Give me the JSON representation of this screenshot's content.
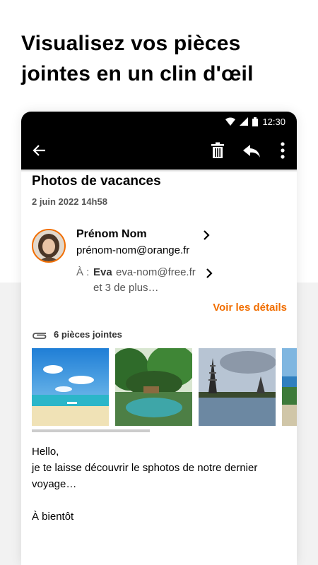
{
  "promo": {
    "headline_line1": "Visualisez vos pièces",
    "headline_line2": "jointes en un clin d'œil"
  },
  "status_bar": {
    "time": "12:30"
  },
  "toolbar": {
    "back_icon": "arrow-left-icon",
    "delete_icon": "trash-icon",
    "reply_icon": "reply-icon",
    "more_icon": "more-vertical-icon"
  },
  "message": {
    "subject": "Photos de vacances",
    "date": "2 juin 2022 14h58",
    "sender": {
      "name": "Prénom Nom",
      "email": "prénom-nom@orange.fr"
    },
    "recipients": {
      "prefix": "À :",
      "first_name": "Eva",
      "first_email": "eva-nom@free.fr",
      "more": "et 3 de plus…"
    },
    "details_link": "Voir les détails",
    "attachments": {
      "count_label": "6 pièces jointes",
      "items": [
        "beach",
        "tropical-garden",
        "temple-lake",
        "coast"
      ]
    },
    "body": [
      "Hello,",
      "je te laisse découvrir le sphotos de notre dernier",
      "voyage…",
      "",
      "À bientôt"
    ]
  },
  "colors": {
    "accent": "#f16e00",
    "appbar": "#000000",
    "background_band": "#f2f2f2"
  }
}
